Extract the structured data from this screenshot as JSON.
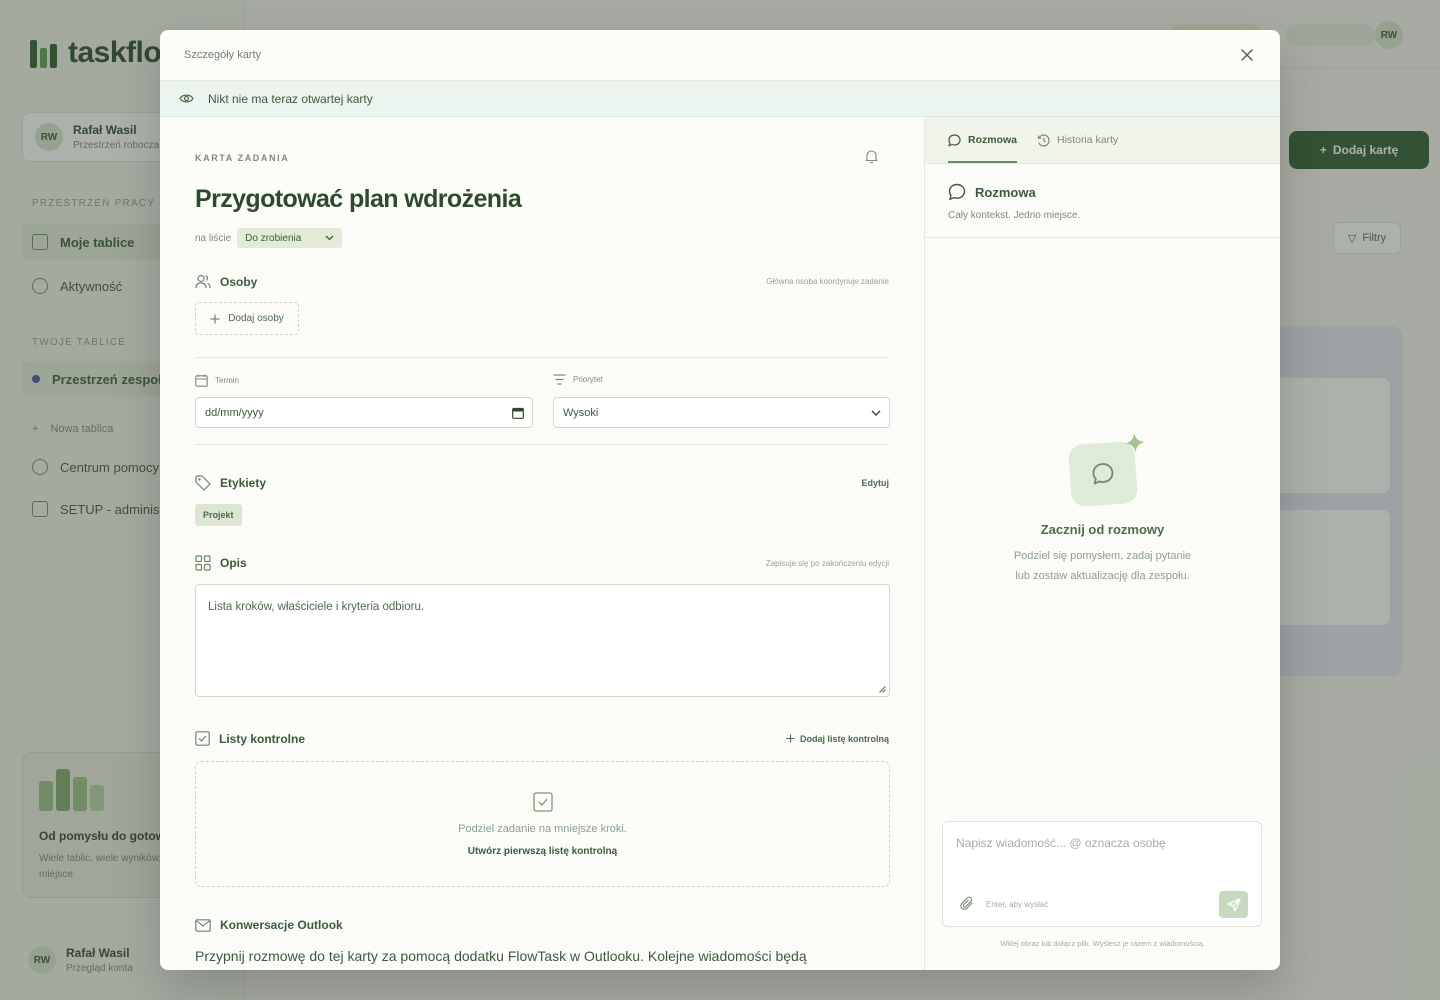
{
  "background": {
    "logo_text": "taskflow",
    "workspace_name": "Rafał Wasil",
    "workspace_sub": "Przestrzeń robocza",
    "section_projects": "Przestrzeń pracy",
    "nav_boards": "Moje tablice",
    "nav_activity": "Aktywność",
    "section_your_boards": "Twoje tablice",
    "board_item": "Przestrzeń zespołu",
    "new_board": "Nowa tablica",
    "help_center": "Centrum pomocy",
    "setup": "SETUP - administracja",
    "promo_title": "Od pomysłu do gotowego",
    "promo_sub": "Wiele tablic, wiele wyników, jedno miejsce",
    "user_name": "Rafał Wasil",
    "user_sub": "Przegląd konta",
    "add_card": "Dodaj kartę",
    "filter": "Filtry",
    "user_initials": "RW"
  },
  "modal": {
    "header_title": "Szczegóły karty",
    "presence_text": "Nikt nie ma teraz otwartej karty",
    "kicker": "KARTA ZADANIA",
    "title": "Przygotować plan wdrożenia",
    "on_list_label": "na liście",
    "list_value": "Do zrobienia",
    "people": {
      "label": "Osoby",
      "hint": "Główna osoba koordynuje zadanie",
      "add_button": "Dodaj osoby"
    },
    "due": {
      "label": "Termin",
      "value": "dd/mm/yyyy"
    },
    "priority": {
      "label": "Priorytet",
      "value": "Wysoki"
    },
    "labels": {
      "label": "Etykiety",
      "edit": "Edytuj",
      "tags": [
        "Projekt"
      ]
    },
    "description": {
      "label": "Opis",
      "hint": "Zapisuje się po zakończeniu edycji",
      "text": "Lista kroków, właściciele i kryteria odbioru."
    },
    "checklists": {
      "label": "Listy kontrolne",
      "add": "Dodaj listę kontrolną",
      "empty_msg": "Podziel zadanie na mniejsze kroki.",
      "empty_cta": "Utwórz pierwszą listę kontrolną"
    },
    "outlook": {
      "label": "Konwersacje Outlook",
      "body": "Przypnij rozmowę do tej karty za pomocą dodatku FlowTask w Outlooku. Kolejne wiadomości będą"
    }
  },
  "panel": {
    "tabs": [
      "Rozmowa",
      "Historia karty"
    ],
    "conv_title": "Rozmowa",
    "conv_sub": "Cały kontekst. Jedno miejsce.",
    "empty_title": "Zacznij od rozmowy",
    "empty_sub_1": "Podziel się pomysłem, zadaj pytanie",
    "empty_sub_2": "lub zostaw aktualizację dla zespołu.",
    "composer_placeholder": "Napisz wiadomość... @ oznacza osobę",
    "composer_hint": "Enter, aby wysłać",
    "paste_hint": "Wklej obraz lub dołącz plik. Wyślesz je razem z wiadomością."
  },
  "colors": {
    "accent": "#3d5a3c",
    "modal_bg": "#fbfcf7",
    "tag_bg": "#dde6d2"
  }
}
